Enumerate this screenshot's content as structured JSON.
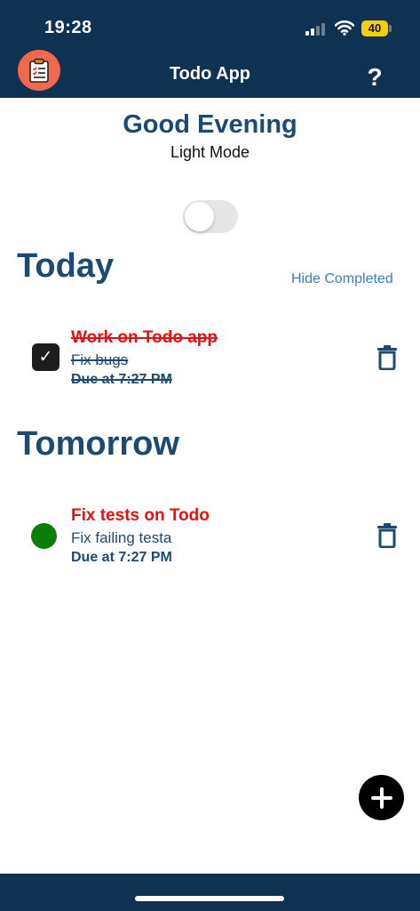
{
  "status_bar": {
    "time": "19:28",
    "battery_level": "40",
    "signal_bars_active": 2,
    "signal_bars_total": 4
  },
  "header": {
    "title": "Todo App",
    "help_label": "?",
    "app_icon": "clipboard-icon"
  },
  "greeting": {
    "text": "Good Evening",
    "mode_label": "Light Mode",
    "toggle_on": false
  },
  "sections": {
    "today": {
      "title": "Today",
      "hide_completed_label": "Hide Completed",
      "todos": [
        {
          "title": "Work on Todo app",
          "description": "Fix bugs",
          "due": "Due at 7:27 PM",
          "completed": true
        }
      ]
    },
    "tomorrow": {
      "title": "Tomorrow",
      "todos": [
        {
          "title": "Fix tests on Todo",
          "description": "Fix failing testa",
          "due": "Due at 7:27 PM",
          "completed": false
        }
      ]
    }
  },
  "fab": {
    "icon": "plus-icon"
  },
  "colors": {
    "navy": "#0f3152",
    "heading_blue": "#1c4a73",
    "link_blue": "#3a7ec6",
    "todo_title_red": "#e81010",
    "pending_green": "#0a7d0a",
    "app_icon_bg": "#f0684d"
  }
}
